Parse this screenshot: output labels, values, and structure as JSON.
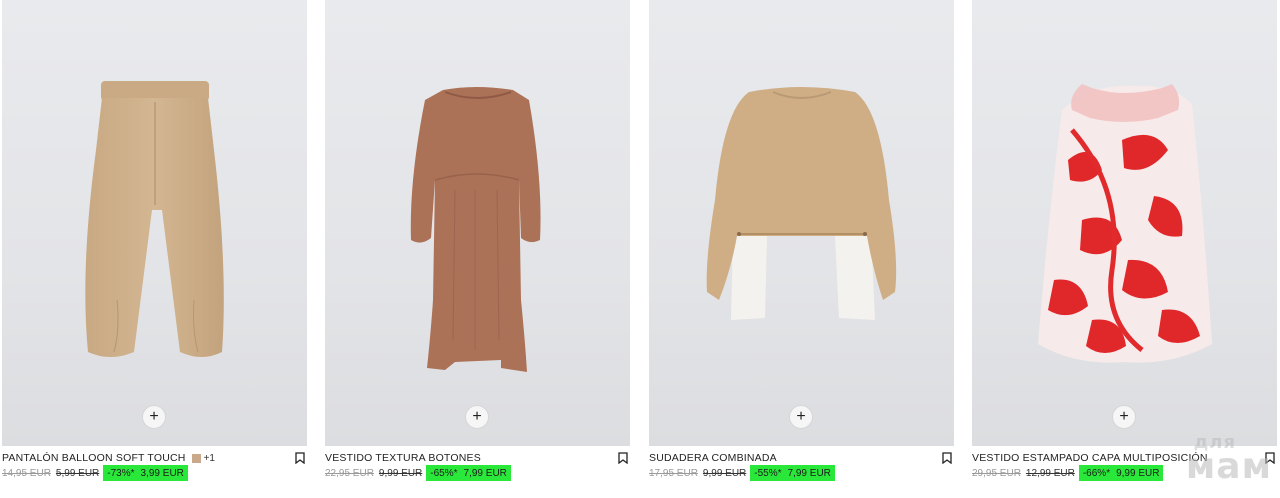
{
  "products": [
    {
      "name": "PANTALÓN BALLOON SOFT TOUCH",
      "color_swatch": "#c9a98a",
      "more_colors": "+1",
      "original_price": "14,95 EUR",
      "previous_price": "5,99 EUR",
      "discount": "-73%*",
      "sale_price": "3,99 EUR",
      "image_icon": "beige-balloon-pants-image"
    },
    {
      "name": "VESTIDO TEXTURA BOTONES",
      "original_price": "22,95 EUR",
      "previous_price": "9,99 EUR",
      "discount": "-65%*",
      "sale_price": "7,99 EUR",
      "image_icon": "brown-textured-dress-image"
    },
    {
      "name": "SUDADERA COMBINADA",
      "original_price": "17,95 EUR",
      "previous_price": "9,99 EUR",
      "discount": "-55%*",
      "sale_price": "7,99 EUR",
      "image_icon": "beige-sweatshirt-white-hem-image"
    },
    {
      "name": "VESTIDO ESTAMPADO CAPA MULTIPOSICIÓN",
      "original_price": "29,95 EUR",
      "previous_price": "12,99 EUR",
      "discount": "-66%*",
      "sale_price": "9,99 EUR",
      "image_icon": "red-floral-print-dress-image"
    }
  ],
  "add_button_label": "+",
  "sale_color": "#2ae83a",
  "watermark": {
    "small": "для",
    "big": "мам"
  }
}
